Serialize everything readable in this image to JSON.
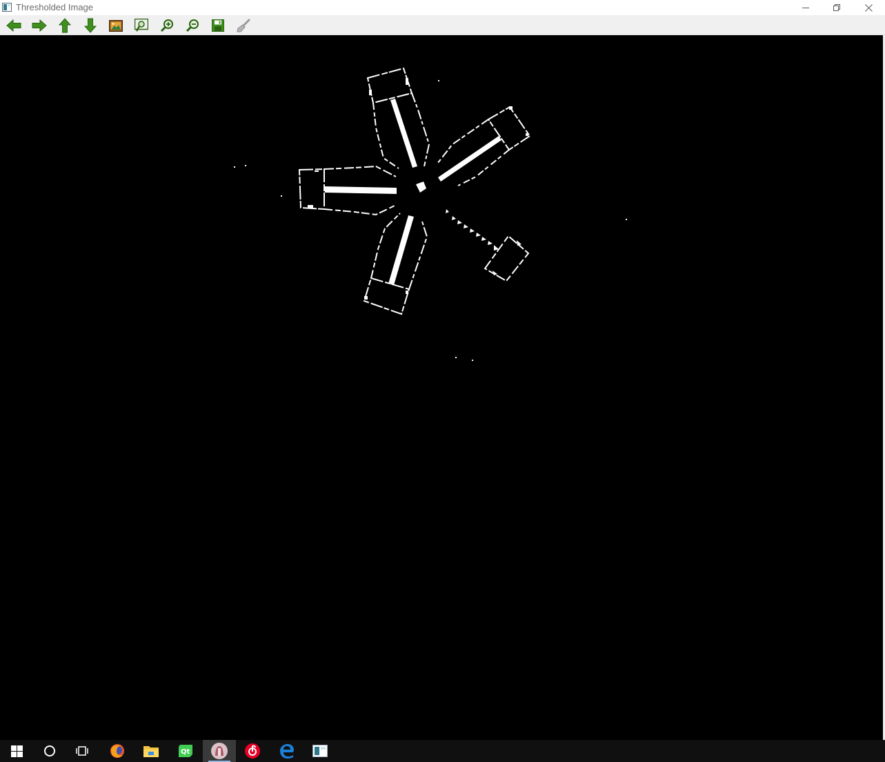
{
  "window": {
    "title": "Thresholded Image"
  },
  "title_bar": {
    "controls": [
      "minimize-icon",
      "restore-icon",
      "close-icon"
    ]
  },
  "toolbar": {
    "buttons": [
      {
        "name": "pan-left-button",
        "icon": "arrow-left-icon"
      },
      {
        "name": "pan-right-button",
        "icon": "arrow-right-icon"
      },
      {
        "name": "pan-up-button",
        "icon": "arrow-up-icon"
      },
      {
        "name": "pan-down-button",
        "icon": "arrow-down-icon"
      },
      {
        "name": "zoom-original-button",
        "icon": "image-icon"
      },
      {
        "name": "zoom-fit-button",
        "icon": "zoom-fit-icon"
      },
      {
        "name": "zoom-in-button",
        "icon": "zoom-in-icon"
      },
      {
        "name": "zoom-out-button",
        "icon": "zoom-out-icon"
      },
      {
        "name": "save-button",
        "icon": "save-icon"
      },
      {
        "name": "properties-button",
        "icon": "brush-icon"
      }
    ],
    "icon_color": "#3f8f1f"
  },
  "canvas": {
    "background": "#000000",
    "foreground": "#ffffff"
  },
  "taskbar": {
    "background": "#101010",
    "items": [
      {
        "name": "start-button",
        "icon": "windows-logo-icon"
      },
      {
        "name": "search-button",
        "icon": "cortana-circle-icon"
      },
      {
        "name": "task-view-button",
        "icon": "task-view-icon"
      },
      {
        "name": "firefox-button",
        "icon": "firefox-icon"
      },
      {
        "name": "file-explorer-button",
        "icon": "folder-icon"
      },
      {
        "name": "qt-creator-button",
        "icon": "qt-icon"
      },
      {
        "name": "paint-button",
        "icon": "paint-icon",
        "active": true
      },
      {
        "name": "netease-music-button",
        "icon": "netease-music-icon"
      },
      {
        "name": "edge-button",
        "icon": "edge-icon"
      },
      {
        "name": "opencv-window-button",
        "icon": "window-app-icon"
      }
    ]
  }
}
